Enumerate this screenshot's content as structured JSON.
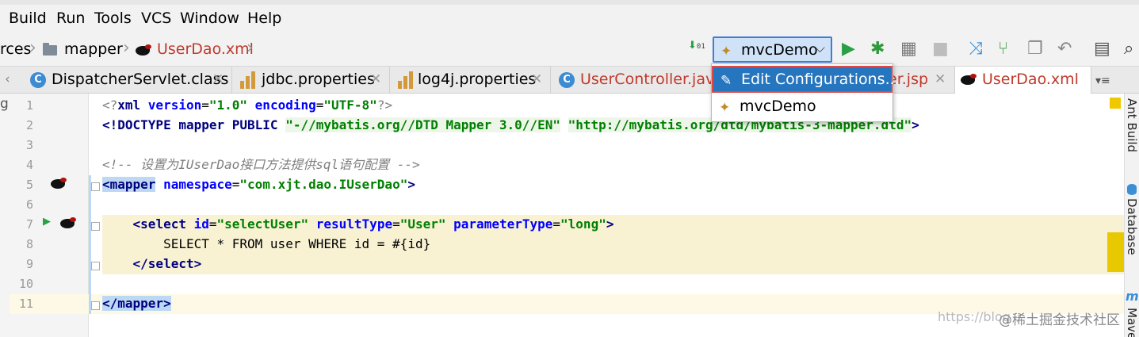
{
  "menu": {
    "items": [
      "Build",
      "Run",
      "Tools",
      "VCS",
      "Window",
      "Help"
    ]
  },
  "breadcrumb": {
    "items": [
      "rces",
      "mapper",
      "UserDao.xml"
    ]
  },
  "toolbar": {
    "run_config": "mvcDemo"
  },
  "tabs": [
    {
      "label": "DispatcherServlet.class"
    },
    {
      "label": "jdbc.properties"
    },
    {
      "label": "log4j.properties"
    },
    {
      "label": "UserController.java"
    },
    {
      "label": "er.jsp"
    },
    {
      "label": "UserDao.xml"
    }
  ],
  "dropdown": {
    "items": [
      "Edit Configurations...",
      "mvcDemo"
    ]
  },
  "editor": {
    "line_numbers": [
      "1",
      "2",
      "3",
      "4",
      "5",
      "6",
      "7",
      "8",
      "9",
      "10",
      "11"
    ],
    "code": {
      "l1_a": "<?",
      "l1_b": "xml ",
      "l1_c": "version",
      "l1_d": "=",
      "l1_e": "\"1.0\" ",
      "l1_f": "encoding",
      "l1_g": "=",
      "l1_h": "\"UTF-8\"",
      "l1_i": "?>",
      "l2_a": "<!DOCTYPE ",
      "l2_b": "mapper PUBLIC ",
      "l2_c": "\"-//mybatis.org//DTD Mapper 3.0//EN\"",
      "l2_d": " ",
      "l2_e": "\"http://mybatis.org/dtd/mybatis-3-mapper.dtd\"",
      "l2_f": ">",
      "l4": "<!-- 设置为IUserDao接口方法提供sql语句配置 -->",
      "l5_a": "<",
      "l5_b": "mapper",
      "l5_c": " namespace",
      "l5_d": "=",
      "l5_e": "\"com.xjt.dao.IUserDao\"",
      "l5_f": ">",
      "l7_a": "    <",
      "l7_b": "select ",
      "l7_c": "id",
      "l7_d": "=",
      "l7_e": "\"selectUser\" ",
      "l7_f": "resultType",
      "l7_g": "=",
      "l7_h": "\"User\" ",
      "l7_i": "parameterType",
      "l7_j": "=",
      "l7_k": "\"long\"",
      "l7_l": ">",
      "l8": "        SELECT * FROM user WHERE id = #{id}",
      "l9_a": "    </",
      "l9_b": "select",
      "l9_c": ">",
      "l11_a": "</",
      "l11_b": "mapper",
      "l11_c": ">"
    }
  },
  "side_panels": [
    "Ant Build",
    "Database",
    "Maven"
  ],
  "watermark": {
    "url": "https://blog",
    "brand": "@稀土掘金技术社区"
  },
  "colors": {
    "selection": "#2675bf",
    "highlight_row": "#f8f2d3",
    "tag_match": "#bcd8f3",
    "run_green": "#2aa046"
  }
}
